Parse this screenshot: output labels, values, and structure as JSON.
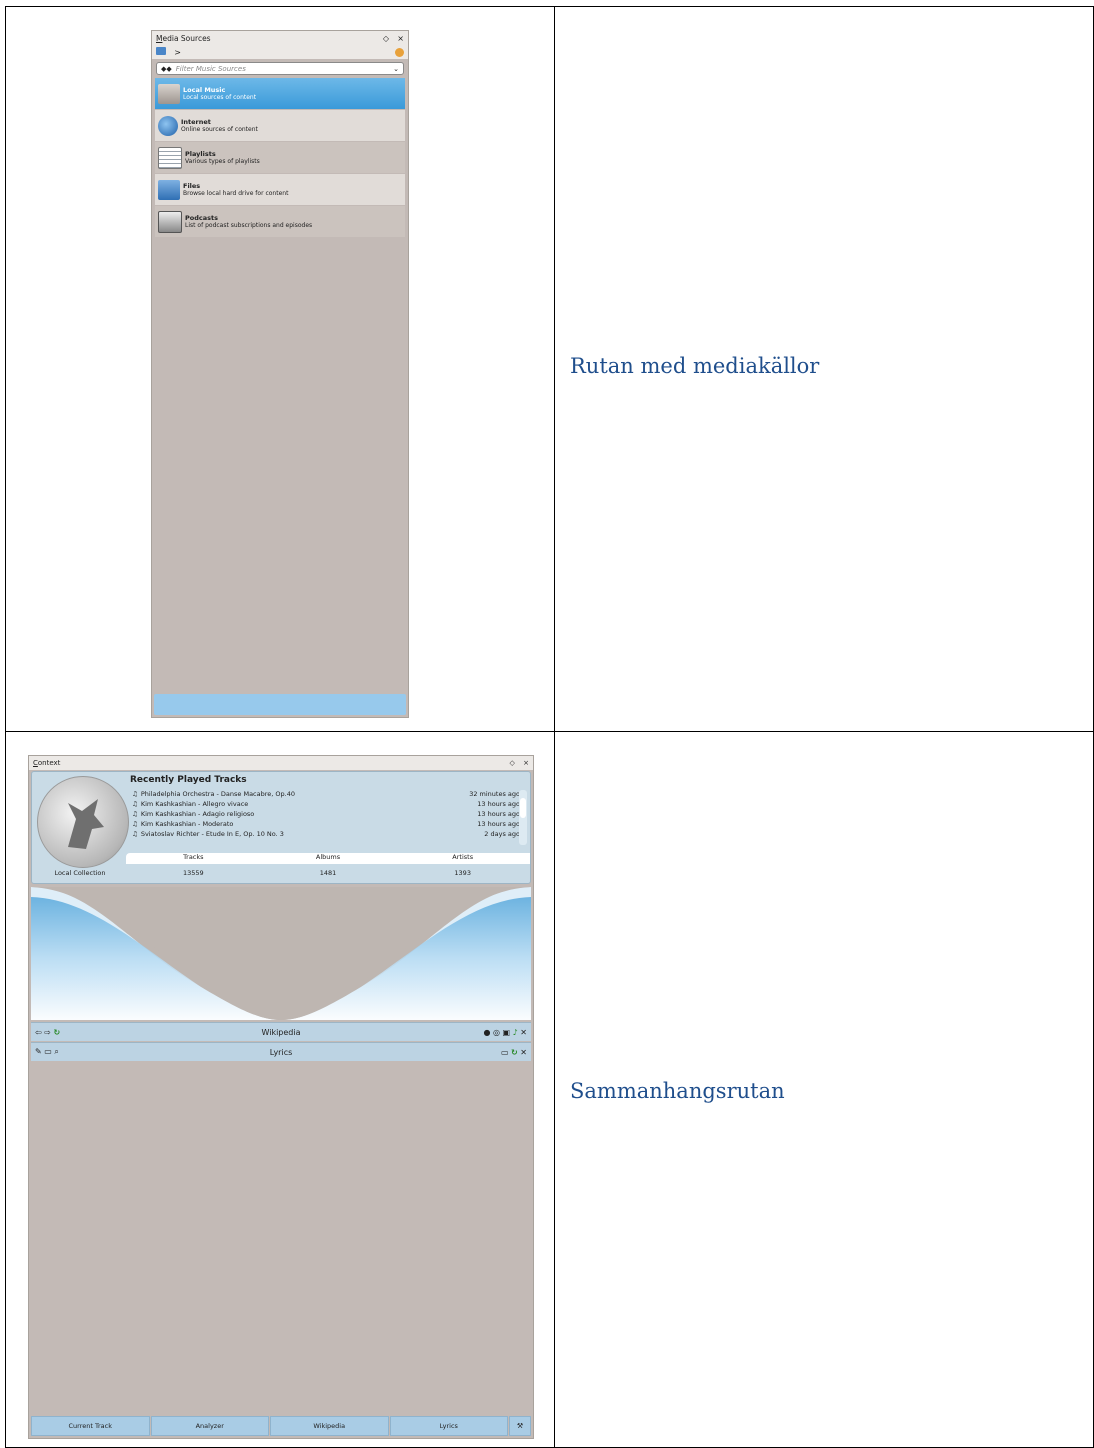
{
  "captions": {
    "row1": "Rutan med mediakällor",
    "row2": "Sammanhangsrutan"
  },
  "media_sources": {
    "title_underlined": "M",
    "title_rest": "edia Sources",
    "float_btn": "◇",
    "close_btn": "×",
    "breadcrumb": ">",
    "filter_placeholder": "Filter Music Sources",
    "sources": [
      {
        "name": "Local Music",
        "desc": "Local sources of content"
      },
      {
        "name": "Internet",
        "desc": "Online sources of content"
      },
      {
        "name": "Playlists",
        "desc": "Various types of playlists"
      },
      {
        "name": "Files",
        "desc": "Browse local hard drive for content"
      },
      {
        "name": "Podcasts",
        "desc": "List of podcast subscriptions and episodes"
      }
    ]
  },
  "context": {
    "title_underlined": "C",
    "title_rest": "ontext",
    "float_btn": "◇",
    "close_btn": "×",
    "recently_played": {
      "title": "Recently Played Tracks",
      "tracks": [
        {
          "track": "Philadelphia Orchestra - Danse Macabre, Op.40",
          "when": "32 minutes ago"
        },
        {
          "track": "Kim Kashkashian - Allegro vivace",
          "when": "13 hours ago"
        },
        {
          "track": "Kim Kashkashian - Adagio religioso",
          "when": "13 hours ago"
        },
        {
          "track": "Kim Kashkashian - Moderato",
          "when": "13 hours ago"
        },
        {
          "track": "Sviatoslav Richter - Etude In E, Op. 10 No. 3",
          "when": "2 days ago"
        }
      ]
    },
    "collection": {
      "label": "Local Collection",
      "headers": [
        "Tracks",
        "Albums",
        "Artists"
      ],
      "values": [
        "13559",
        "1481",
        "1393"
      ]
    },
    "wikipedia_title": "Wikipedia",
    "lyrics_title": "Lyrics",
    "tabs": [
      "Current Track",
      "Analyzer",
      "Wikipedia",
      "Lyrics"
    ],
    "colors": {
      "accent": "#3a9ad9",
      "panel_bg": "#c3bab6",
      "applet_bg": "#c9dbe6"
    }
  }
}
